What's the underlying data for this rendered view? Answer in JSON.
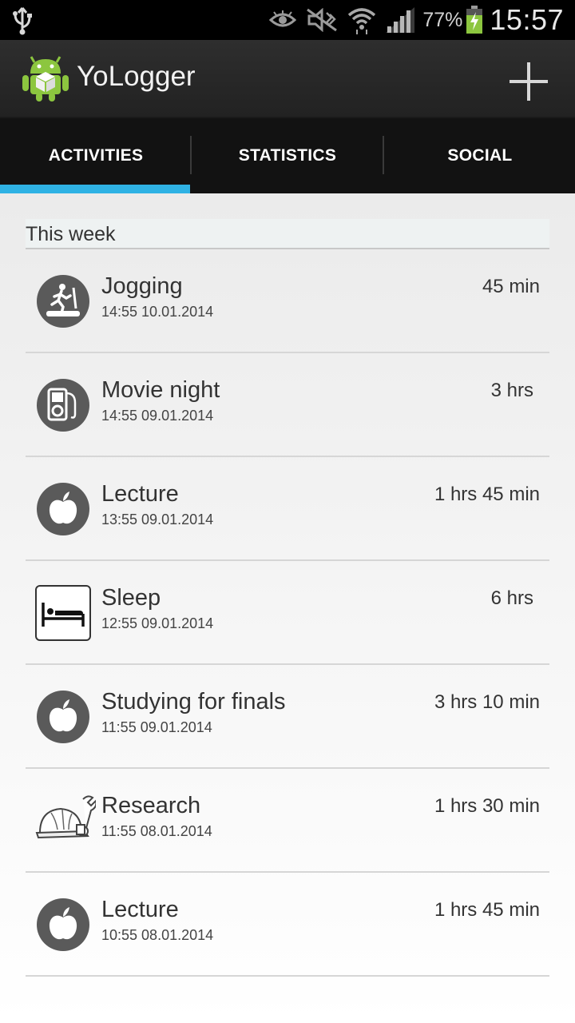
{
  "status_bar": {
    "battery_percent": "77%",
    "time": "15:57",
    "icons": [
      "usb-icon",
      "eye-icon",
      "mute-icon",
      "wifi-icon",
      "signal-icon",
      "battery-charging-icon"
    ]
  },
  "action_bar": {
    "title": "YoLogger",
    "logo": "android-logo",
    "add_icon": "plus-icon"
  },
  "tabs": [
    {
      "label": "ACTIVITIES",
      "selected": true
    },
    {
      "label": "STATISTICS",
      "selected": false
    },
    {
      "label": "SOCIAL",
      "selected": false
    }
  ],
  "accent_color": "#2fb2e4",
  "section": {
    "label": "This week"
  },
  "activities": [
    {
      "title": "Jogging",
      "datetime": "14:55 10.01.2014",
      "duration": "45 min",
      "icon": "treadmill-icon"
    },
    {
      "title": "Movie night",
      "datetime": "14:55 09.01.2014",
      "duration": "3 hrs",
      "icon": "media-player-icon"
    },
    {
      "title": "Lecture",
      "datetime": "13:55 09.01.2014",
      "duration": "1 hrs 45 min",
      "icon": "apple-icon"
    },
    {
      "title": "Sleep",
      "datetime": "12:55 09.01.2014",
      "duration": "6 hrs",
      "icon": "bed-icon"
    },
    {
      "title": "Studying for finals",
      "datetime": "11:55 09.01.2014",
      "duration": "3 hrs 10 min",
      "icon": "apple-icon"
    },
    {
      "title": "Research",
      "datetime": "11:55 08.01.2014",
      "duration": "1 hrs 30 min",
      "icon": "hardhat-wrench-icon"
    },
    {
      "title": "Lecture",
      "datetime": "10:55 08.01.2014",
      "duration": "1 hrs 45 min",
      "icon": "apple-icon"
    }
  ]
}
